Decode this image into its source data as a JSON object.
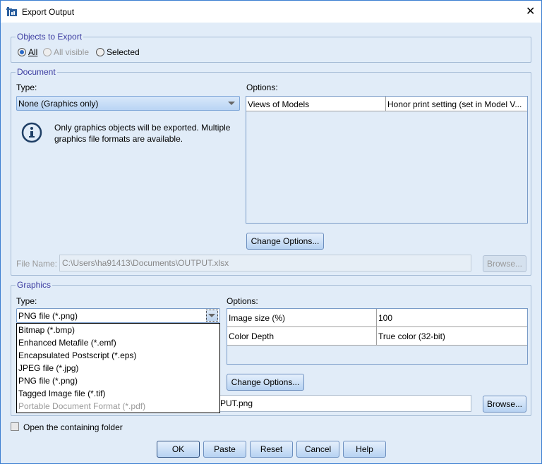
{
  "window": {
    "title": "Export Output",
    "close_icon": "close-icon",
    "app_icon": "spss-app-icon"
  },
  "objects": {
    "legend": "Objects to Export",
    "options": [
      {
        "label": "All",
        "selected": true,
        "enabled": true
      },
      {
        "label": "All visible",
        "selected": false,
        "enabled": false
      },
      {
        "label": "Selected",
        "selected": false,
        "enabled": true
      }
    ]
  },
  "document": {
    "legend": "Document",
    "type_label": "Type:",
    "type_value": "None (Graphics only)",
    "info_icon": "info-icon",
    "info_text_1": "Only graphics objects will be exported. Multiple",
    "info_text_2": "graphics file formats are available.",
    "options_label": "Options:",
    "options_rows": [
      {
        "name": "Views of Models",
        "value": "Honor print setting (set in Model V..."
      }
    ],
    "change_options": "Change Options...",
    "file_name_label": "File Name:",
    "file_name_value": "C:\\Users\\ha91413\\Documents\\OUTPUT.xlsx",
    "browse": "Browse..."
  },
  "graphics": {
    "legend": "Graphics",
    "type_label": "Type:",
    "type_value": "PNG file (*.png)",
    "dropdown_items": [
      {
        "label": "Bitmap (*.bmp)",
        "enabled": true
      },
      {
        "label": "Enhanced Metafile (*.emf)",
        "enabled": true
      },
      {
        "label": "Encapsulated Postscript (*.eps)",
        "enabled": true
      },
      {
        "label": "JPEG file (*.jpg)",
        "enabled": true
      },
      {
        "label": "PNG file (*.png)",
        "enabled": true
      },
      {
        "label": "Tagged Image file (*.tif)",
        "enabled": true
      },
      {
        "label": "Portable Document Format (*.pdf)",
        "enabled": false
      }
    ],
    "options_label": "Options:",
    "options_rows": [
      {
        "name": "Image size (%)",
        "value": "100"
      },
      {
        "name": "Color Depth",
        "value": "True color (32-bit)"
      }
    ],
    "change_options": "Change Options...",
    "file_name_visible": "PUT.png",
    "browse": "Browse..."
  },
  "open_folder": {
    "label": "Open the containing folder",
    "checked": false
  },
  "buttons": {
    "ok": "OK",
    "paste": "Paste",
    "reset": "Reset",
    "cancel": "Cancel",
    "help": "Help"
  }
}
